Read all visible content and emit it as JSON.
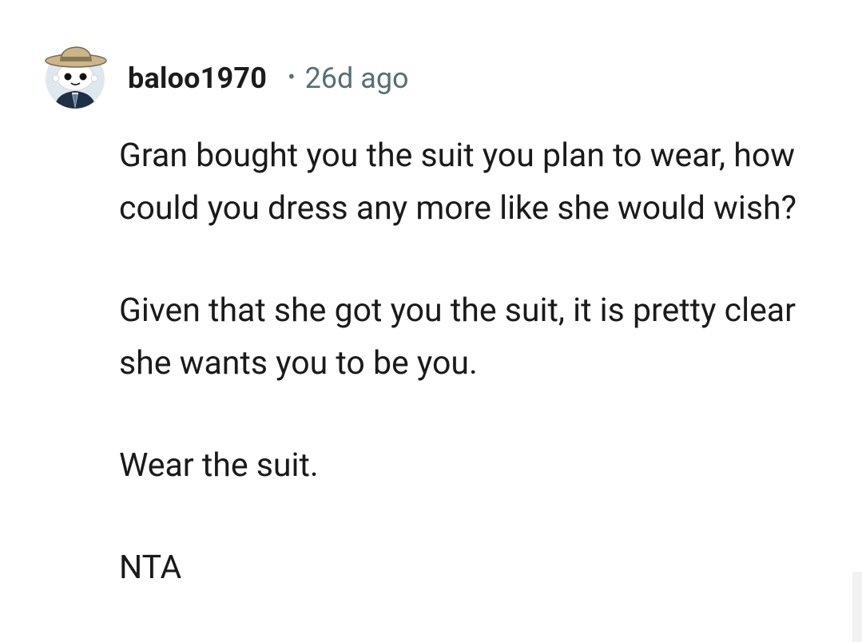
{
  "comment": {
    "username": "baloo1970",
    "separator": "•",
    "time_ago": "26d ago",
    "avatar_icon": "snoo-avatar-icon",
    "paragraphs": [
      "Gran bought you the suit you plan to wear, how could you dress any more like she would wish?",
      "Given that she got you the suit, it is pretty clear she wants you to be you.",
      "Wear the suit.",
      "NTA"
    ]
  },
  "colors": {
    "text": "#1a1a1b",
    "meta": "#576f76",
    "background": "#ffffff"
  }
}
